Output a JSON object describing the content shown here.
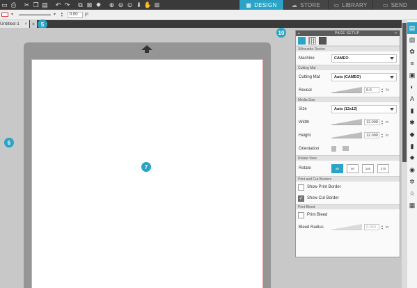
{
  "toolbar": {
    "icons": [
      "save-icon",
      "print-icon",
      "cut-icon",
      "copy-icon",
      "paste-icon",
      "undo-icon",
      "redo-icon",
      "group-icon",
      "ungroup-icon",
      "sparkle-icon",
      "zoom-in-icon",
      "zoom-out-icon",
      "zoom-fit-icon",
      "hand-icon",
      "select-all-icon"
    ]
  },
  "nav_tabs": [
    {
      "label": "DESIGN",
      "active": true
    },
    {
      "label": "STORE",
      "active": false
    },
    {
      "label": "LIBRARY",
      "active": false
    },
    {
      "label": "SEND",
      "active": false
    }
  ],
  "linebar": {
    "line_width": "0.00",
    "unit": "pt"
  },
  "document_tab": {
    "title": "Untitled-1",
    "close": "×",
    "add": "+"
  },
  "badges": {
    "doc_tabs": "5",
    "canvas": "6",
    "page": "7",
    "panel": "10"
  },
  "panel": {
    "title": "PAGE SETUP",
    "sections": {
      "machine": "Silhouette Device",
      "cutting_mat": "Cutting Mat",
      "media_size": "Media Size",
      "rotate_view": "Rotate View",
      "print_cut_borders": "Print and Cut Borders",
      "print_bleed": "Print Bleed"
    },
    "machine_label": "Machine",
    "machine_value": "CAMEO",
    "cutting_mat_label": "Cutting Mat",
    "cutting_mat_value": "Auto (CAMEO)",
    "reveal_label": "Reveal",
    "reveal_value": "0.0",
    "reveal_unit": "%",
    "size_label": "Size",
    "size_value": "Auto (12x12)",
    "width_label": "Width",
    "width_value": "12.000",
    "height_label": "Height",
    "height_value": "12.000",
    "dim_unit": "in",
    "orientation_label": "Orientation",
    "rotate_label": "Rotate",
    "rotate_buttons": [
      "ab",
      "90",
      "180",
      "270"
    ],
    "show_print_border": "Show Print Border",
    "show_cut_border": "Show Cut Border",
    "print_bleed": "Print Bleed",
    "bleed_radius_label": "Bleed Radius",
    "bleed_radius_value": "0.050",
    "bleed_unit": "in",
    "show_print_border_checked": false,
    "show_cut_border_checked": true,
    "print_bleed_checked": false
  },
  "rightbar": {
    "icons": [
      "page-setup-icon",
      "design-icon",
      "fill-color-icon",
      "line-style-icon",
      "transform-icon",
      "shadow-icon",
      "text-style-icon",
      "align-icon",
      "replicate-icon",
      "modify-icon",
      "offset-icon",
      "trace-icon",
      "library-icon",
      "rhinestone-icon",
      "sketch-icon",
      "star-icon",
      "pattern-icon"
    ],
    "accent": "#2aa3c6"
  },
  "colors": {
    "accent": "#2aa3c6",
    "toolbar": "#3a3a3a",
    "canvas": "#c8c8c8",
    "mat": "#959595"
  }
}
